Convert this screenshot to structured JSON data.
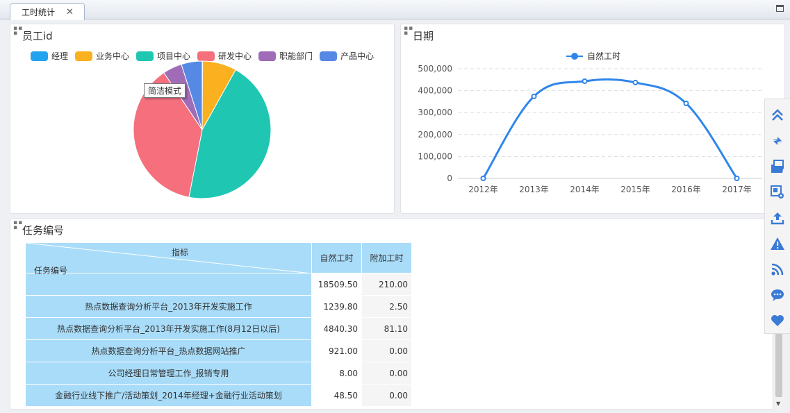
{
  "tabs": [
    {
      "label": "工时统计"
    }
  ],
  "panels": {
    "employee": {
      "title": "员工id",
      "tooltip": "简洁模式"
    },
    "date": {
      "title": "日期"
    },
    "task": {
      "title": "任务编号"
    }
  },
  "chart_data": [
    {
      "type": "pie",
      "title": "员工id",
      "legend_position": "top",
      "categories": [
        "经理",
        "业务中心",
        "项目中心",
        "研发中心",
        "职能部门",
        "产品中心"
      ],
      "values": [
        0.1,
        8.0,
        45.0,
        37.5,
        4.5,
        4.9
      ],
      "colors": [
        "#22a3ef",
        "#fbb01f",
        "#1fc7b3",
        "#f56f7d",
        "#a06cb8",
        "#5689e3"
      ]
    },
    {
      "type": "line",
      "title": "日期",
      "legend_position": "top",
      "categories": [
        "2012年",
        "2013年",
        "2014年",
        "2015年",
        "2016年",
        "2017年"
      ],
      "series": [
        {
          "name": "自然工时",
          "values": [
            0,
            374000,
            443000,
            437000,
            342000,
            0
          ],
          "color": "#2f86ea"
        }
      ],
      "y_ticks": [
        "0",
        "100,000",
        "200,000",
        "300,000",
        "400,000",
        "500,000"
      ],
      "ylim": [
        0,
        500000
      ],
      "grid": true,
      "smooth": true
    }
  ],
  "table": {
    "corner_top": "指标",
    "corner_bottom": "任务编号",
    "columns": [
      "自然工时",
      "附加工时"
    ],
    "rows": [
      {
        "name": "",
        "natural": "18509.50",
        "extra": "210.00"
      },
      {
        "name": "热点数据查询分析平台_2013年开发实施工作",
        "natural": "1239.80",
        "extra": "2.50"
      },
      {
        "name": "热点数据查询分析平台_2013年开发实施工作(8月12日以后)",
        "natural": "4840.30",
        "extra": "81.10"
      },
      {
        "name": "热点数据查询分析平台_热点数据网站推广",
        "natural": "921.00",
        "extra": "0.00"
      },
      {
        "name": "公司经理日常管理工作_报销专用",
        "natural": "8.00",
        "extra": "0.00"
      },
      {
        "name": "金融行业线下推广/活动策划_2014年经理+金融行业活动策划",
        "natural": "48.50",
        "extra": "0.00"
      }
    ]
  },
  "toolbar_icons": [
    "collapse-up-icon",
    "refresh-icon",
    "folder-image-icon",
    "image-settings-icon",
    "upload-icon",
    "warning-icon",
    "rss-icon",
    "chat-icon",
    "heart-icon"
  ],
  "accent_color": "#3a7bd5"
}
